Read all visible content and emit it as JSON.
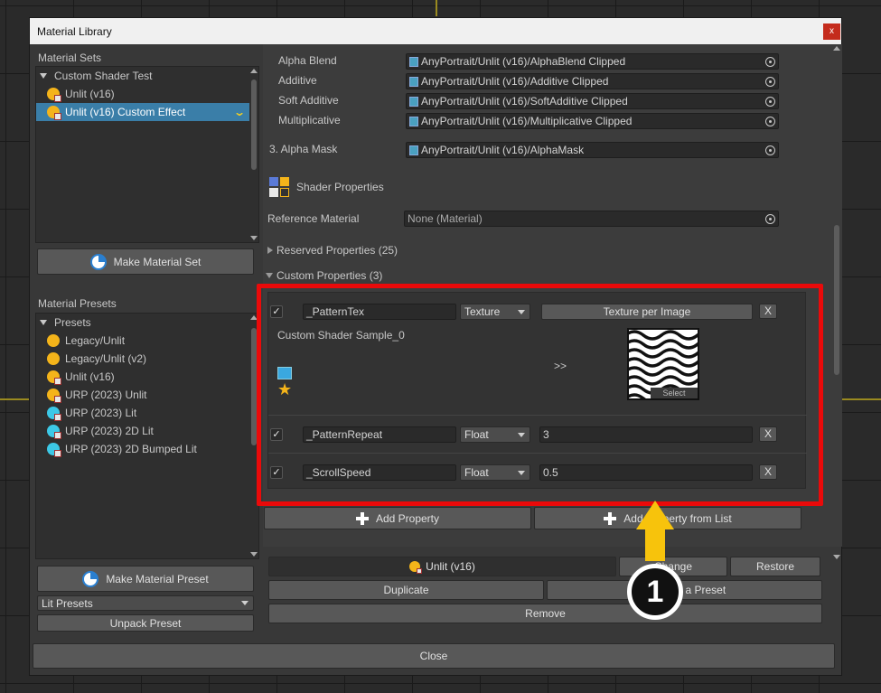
{
  "window": {
    "title": "Material Library",
    "close_glyph": "x"
  },
  "material_sets": {
    "title": "Material Sets",
    "root": "Custom Shader Test",
    "items": [
      "Unlit (v16)",
      "Unlit (v16) Custom Effect"
    ],
    "make_button": "Make Material Set"
  },
  "material_presets": {
    "title": "Material Presets",
    "root": "Presets",
    "items": [
      "Legacy/Unlit",
      "Legacy/Unlit (v2)",
      "Unlit (v16)",
      "URP (2023) Unlit",
      "URP (2023) Lit",
      "URP (2023) 2D Lit",
      "URP (2023) 2D Bumped Lit"
    ],
    "make_button": "Make Material Preset",
    "dropdown_value": "Lit Presets",
    "unpack_button": "Unpack Preset"
  },
  "shaders": {
    "alpha_blend": {
      "label": "Alpha Blend",
      "value": "AnyPortrait/Unlit (v16)/AlphaBlend Clipped"
    },
    "additive": {
      "label": "Additive",
      "value": "AnyPortrait/Unlit (v16)/Additive Clipped"
    },
    "soft_additive": {
      "label": "Soft Additive",
      "value": "AnyPortrait/Unlit (v16)/SoftAdditive Clipped"
    },
    "multiplicative": {
      "label": "Multiplicative",
      "value": "AnyPortrait/Unlit (v16)/Multiplicative Clipped"
    },
    "alpha_mask": {
      "label": "3. Alpha Mask",
      "value": "AnyPortrait/Unlit (v16)/AlphaMask"
    }
  },
  "shader_properties": {
    "title": "Shader Properties",
    "reference_label": "Reference Material",
    "reference_value": "None (Material)",
    "reserved": "Reserved Properties (25)",
    "custom": "Custom Properties (3)"
  },
  "custom_props": [
    {
      "name": "_PatternTex",
      "type": "Texture",
      "value": "Texture per Image",
      "check": "✓",
      "remove": "X"
    },
    {
      "name": "_PatternRepeat",
      "type": "Float",
      "value": "3",
      "check": "✓",
      "remove": "X"
    },
    {
      "name": "_ScrollSpeed",
      "type": "Float",
      "value": "0.5",
      "check": "✓",
      "remove": "X"
    }
  ],
  "texture_row": {
    "sample_name": "Custom Shader Sample_0",
    "arrow": ">>",
    "select_label": "Select"
  },
  "buttons": {
    "add_property": "Add Property",
    "add_from_list": "Add Property from List",
    "current_preset": "Unlit (v16)",
    "change": "Change",
    "restore": "Restore",
    "duplicate": "Duplicate",
    "save_preset": "Save as a Preset",
    "remove": "Remove",
    "close": "Close"
  },
  "annotation": {
    "number": "1"
  },
  "colors": {
    "highlight_red": "#ea0a0a",
    "arrow_yellow": "#f7c30c",
    "selected": "#3a7ea8"
  }
}
